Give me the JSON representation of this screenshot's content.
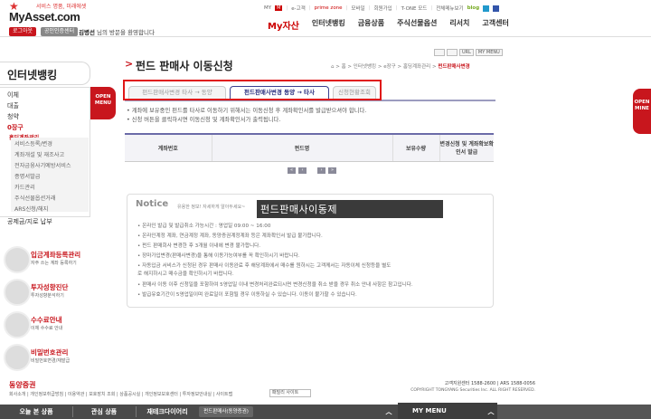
{
  "header": {
    "slogan": "서비스 명품, 미래에셋",
    "logo": "MyAsset.com",
    "logout_btn": "로그아웃",
    "cert_btn": "공인인증센터",
    "welcome_name": "김병선",
    "welcome_rest": "님의 방문을 환영합니다",
    "util": [
      "MY",
      "e-고객",
      "prime zone",
      "모바일",
      "회원가입",
      "T-ONE 모드",
      "전체메뉴보기"
    ],
    "gnb": [
      "My자산",
      "인터넷뱅킹",
      "금융상품",
      "주식선물옵션",
      "리서치",
      "고객센터"
    ],
    "top_buttons": [
      "URL",
      "MY MENU"
    ]
  },
  "sidebar": {
    "title": "인터넷뱅킹",
    "items": [
      "이체",
      "대출",
      "청약",
      "0장구",
      "홈딩계좌관리"
    ],
    "subs": [
      "서비스등록/변경",
      "계좌개설 및 재조사고",
      "전자금융사기예방서비스",
      "증명서발급",
      "카드관리",
      "주식선물옵션거래",
      "ARS신청/해지"
    ],
    "last_item": "공제금/지로 납부",
    "open_menu": [
      "OPEN",
      "MENU"
    ],
    "quick": [
      {
        "title": "입금계좌등록관리",
        "sub": "자주 쓰는 계좌 등록하기"
      },
      {
        "title": "투자성향진단",
        "sub": "투자성향분석하기"
      },
      {
        "title": "수수료안내",
        "sub": "이체 수수료 안내"
      },
      {
        "title": "비밀번호관리",
        "sub": "비밀번호변경/재발급"
      }
    ]
  },
  "right_tab": [
    "OPEN",
    "MINE"
  ],
  "main": {
    "title": "펀드 판매사 이동신청",
    "breadcrumb": [
      "홈",
      "인터넷뱅킹",
      "e장구",
      "홈딩계좌관리"
    ],
    "breadcrumb_current": "펀드판매사변경",
    "tabs": [
      "펀드판매사변경 타사 → 동양",
      "펀드판매사변경 동양 → 타사",
      "신청현황조회"
    ],
    "notes": [
      "• 계좌에 보유중인 펀드를 타사로 이동하기 위해서는 이동신청 후 계좌확인서를 발급받으셔야 합니다.",
      "• 신청 버튼을 클릭하시면 이동신청 및 계좌확인서가 출력됩니다."
    ],
    "table_headers": [
      "계좌번호",
      "펀드명",
      "보유수량",
      "변경신청 및 계좌확보확인서 발급"
    ],
    "pager": [
      "«",
      "‹",
      "›",
      "»"
    ],
    "notice_title": "Notice",
    "notice_sub": "유용한 정보! 자세하게 알아두세요~",
    "overlay_text": "펀드판매사이동제",
    "notice_lines": [
      "• 온라인 발급 및 발급취소 가능시간 : 영업일 09:00 ~ 16:00",
      "• 온라인계정 계좌, 연금계정 계좌, 동양증권계정계좌 등은 계좌확인서 발급 불가합니다.",
      "• 펀드 판매회사 변경한 후 3개월 이내에 변경 불가합니다.",
      "• 장마가입변경(판매사변경)을 통해 이동가능여부를 꼭 확인하시기 바랍니다.",
      "• 자동입금 서비스가 신청된 경우 판매사 이동완료 후 해당계좌에서 매수를 원하시는 고객께서는 자동이체 신청등을 별도",
      "  로 해지하시고 매수금을 확인하시기 바랍니다.",
      "• 판매사 이동 이후 신청일을 포함하여 5영업일 이내 변경처리완료되시면 변경신청을 취소 받을 경우 취소 안내 사항은 참고입니다.",
      "• 발급유효기간이 5영업일이며 완료일이 포함될 경우 이동하실 수 있습니다. 이동이 불가할 수 있습니다."
    ]
  },
  "footer": {
    "logo": "동양증권",
    "links": "회사소개 | 개인정보취급방침 | 이용약관 | 보호장치 조회 | 상품공시실 | 개인정보보호센터 | 투자정보안내실 | 사이트맵",
    "select": "패밀리 사이트",
    "call": "고객지원센터 1588-2600 | ARS 1588-0056",
    "copyright": "COPYRIGHT TONGYANG Securities Inc. ALL RIGHT RESERVED."
  },
  "bottombar": {
    "items": [
      "오늘 본 상품",
      "관심 상품",
      "재테크다이어리"
    ],
    "extra": "펀드판매사(동양증권)",
    "my_menu": "MY MENU"
  }
}
